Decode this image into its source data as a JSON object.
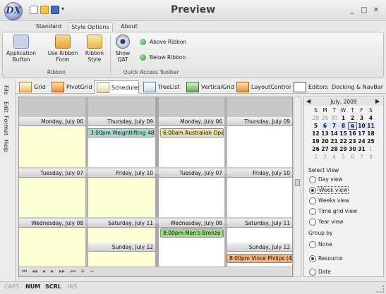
{
  "window": {
    "title": "Preview",
    "logo_letter": "DX"
  },
  "ribbon": {
    "tabs": [
      {
        "label": "Standard"
      },
      {
        "label": "Style Options"
      },
      {
        "label": "About"
      }
    ],
    "buttons": {
      "app_button": "Application Button",
      "use_ribbon_form": "Use Ribbon Form",
      "ribbon_style": "Ribbon Style",
      "show_qat": "Show QAT",
      "above_ribbon": "Above Ribbon",
      "below_ribbon": "Below Ribbon"
    },
    "groups": {
      "ribbon": "Ribbon",
      "qat": "Quick Access Toolbar"
    }
  },
  "left_menu": [
    "File",
    "Edit",
    "Format",
    "Help"
  ],
  "content_tabs": [
    "Grid",
    "PivotGrid",
    "Scheduler",
    "TreeList",
    "VerticalGrid",
    "LayoutControl",
    "Editors",
    "Docking & NavBar"
  ],
  "scheduler": {
    "days": {
      "mon6": "Monday, July 06",
      "thu9": "Thursday, July 09",
      "mon6b": "Monday, July 06",
      "thu9b": "Thursday, July 09",
      "tue7": "Tuesday, July 07",
      "fri10": "Friday, July 10",
      "tue7b": "Tuesday, July 07",
      "fri10b": "Friday, July 10",
      "wed8": "Wednesday, July 08",
      "sat11": "Saturday, July 11",
      "wed8b": "Wednesday, July 08",
      "sat11b": "Saturday, July 11",
      "sun12": "Sunday, July 12",
      "sun12b": "Sunday, July 12"
    },
    "appointments": {
      "weightlifting": "3:00pm Weightlifting 48",
      "australian": "6:00am Australian Ope",
      "bronze": "8:00pm Men's Bronze M",
      "philips": "8:00pm Vince Philips (4"
    },
    "colors": {
      "weightlifting": "#a9dcd0",
      "australian": "#e8e0a6",
      "bronze": "#9edb86",
      "philips": "#f7b27a",
      "highlight": "#ffffd5"
    }
  },
  "calendar": {
    "title": "July, 2009",
    "weekday_headers": [
      "S",
      "M",
      "T",
      "W",
      "T",
      "F",
      "S"
    ],
    "weeks": [
      [
        "28",
        "29",
        "30",
        "1",
        "2",
        "3",
        "4"
      ],
      [
        "5",
        "6",
        "7",
        "8",
        "9",
        "10",
        "11"
      ],
      [
        "12",
        "13",
        "14",
        "15",
        "16",
        "17",
        "18"
      ],
      [
        "19",
        "20",
        "21",
        "22",
        "23",
        "24",
        "25"
      ],
      [
        "26",
        "27",
        "28",
        "29",
        "30",
        "31",
        "1"
      ],
      [
        "2",
        "3",
        "4",
        "5",
        "6",
        "7",
        "8"
      ]
    ]
  },
  "select_view": {
    "label": "Select View",
    "options": [
      "Day view",
      "Week view",
      "Weeks view",
      "Time grid view",
      "Year view"
    ],
    "selected": "Week view"
  },
  "group_by": {
    "label": "Group by",
    "options": [
      "None",
      "Resource",
      "Date"
    ],
    "selected": "Resource"
  },
  "status": {
    "caps": "CAPS",
    "num": "NUM",
    "scrl": "SCRL",
    "ins": "INS"
  }
}
